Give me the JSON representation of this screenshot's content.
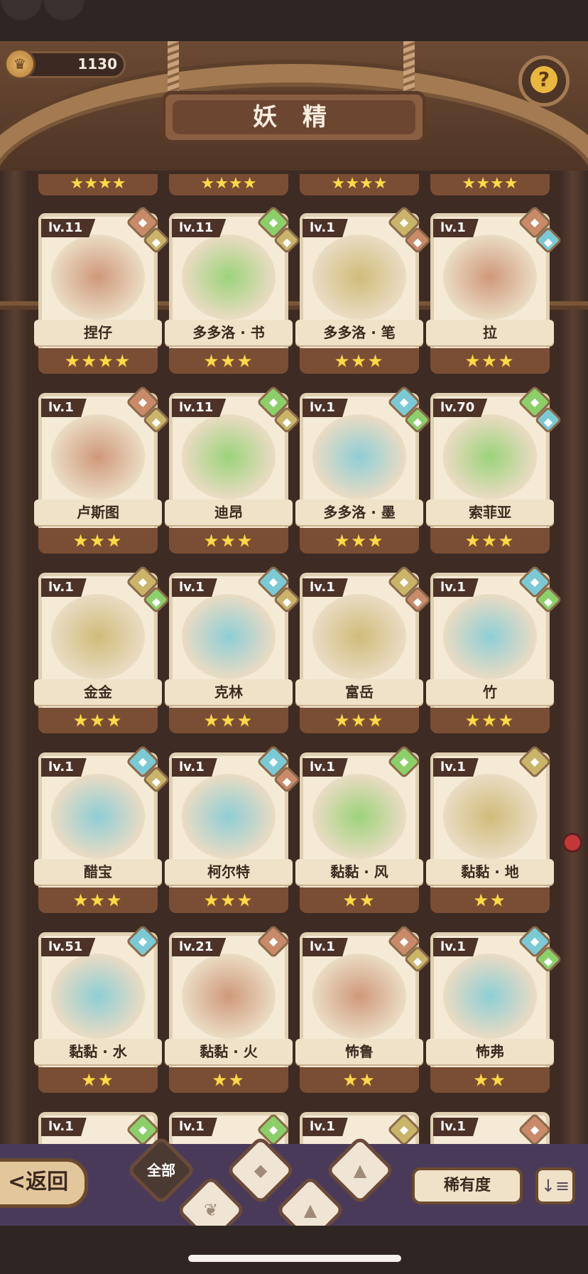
{
  "header": {
    "title": "妖 精",
    "coins": "1130",
    "help_symbol": "?"
  },
  "colors": {
    "water": "#7cc9d6",
    "plant": "#8ccf6a",
    "earth": "#c9b46a",
    "fire": "#c98a6a",
    "star": "#ffd94a"
  },
  "top_partial_stars": [
    "★★★★",
    "★★★★",
    "★★★★",
    "★★★★"
  ],
  "cards": [
    {
      "level": "lv.11",
      "name": "捏仔",
      "stars": "★★★★",
      "el1": "fire",
      "el2": "earth"
    },
    {
      "level": "lv.11",
      "name": "多多洛 · 书",
      "stars": "★★★",
      "el1": "plant",
      "el2": "earth"
    },
    {
      "level": "lv.1",
      "name": "多多洛 · 笔",
      "stars": "★★★",
      "el1": "earth",
      "el2": "fire"
    },
    {
      "level": "lv.1",
      "name": "拉",
      "stars": "★★★",
      "el1": "fire",
      "el2": "water"
    },
    {
      "level": "lv.1",
      "name": "卢斯图",
      "stars": "★★★",
      "el1": "fire",
      "el2": "earth"
    },
    {
      "level": "lv.11",
      "name": "迪昂",
      "stars": "★★★",
      "el1": "plant",
      "el2": "earth"
    },
    {
      "level": "lv.1",
      "name": "多多洛 · 墨",
      "stars": "★★★",
      "el1": "water",
      "el2": "plant"
    },
    {
      "level": "lv.70",
      "name": "索菲亚",
      "stars": "★★★",
      "el1": "plant",
      "el2": "water"
    },
    {
      "level": "lv.1",
      "name": "金金",
      "stars": "★★★",
      "el1": "earth",
      "el2": "plant"
    },
    {
      "level": "lv.1",
      "name": "克林",
      "stars": "★★★",
      "el1": "water",
      "el2": "earth"
    },
    {
      "level": "lv.1",
      "name": "富岳",
      "stars": "★★★",
      "el1": "earth",
      "el2": "fire"
    },
    {
      "level": "lv.1",
      "name": "竹",
      "stars": "★★★",
      "el1": "water",
      "el2": "plant"
    },
    {
      "level": "lv.1",
      "name": "醋宝",
      "stars": "★★★",
      "el1": "water",
      "el2": "earth"
    },
    {
      "level": "lv.1",
      "name": "柯尔特",
      "stars": "★★★",
      "el1": "water",
      "el2": "fire"
    },
    {
      "level": "lv.1",
      "name": "黏黏 · 风",
      "stars": "★★",
      "el1": "plant",
      "el2": ""
    },
    {
      "level": "lv.1",
      "name": "黏黏 · 地",
      "stars": "★★",
      "el1": "earth",
      "el2": ""
    },
    {
      "level": "lv.51",
      "name": "黏黏 · 水",
      "stars": "★★",
      "el1": "water",
      "el2": ""
    },
    {
      "level": "lv.21",
      "name": "黏黏 · 火",
      "stars": "★★",
      "el1": "fire",
      "el2": ""
    },
    {
      "level": "lv.1",
      "name": "怖鲁",
      "stars": "★★",
      "el1": "fire",
      "el2": "earth"
    },
    {
      "level": "lv.1",
      "name": "怖弗",
      "stars": "★★",
      "el1": "water",
      "el2": "plant"
    }
  ],
  "bottom_partial": [
    {
      "level": "lv.1",
      "el1": "plant"
    },
    {
      "level": "lv.1",
      "el1": "plant"
    },
    {
      "level": "lv.1",
      "el1": "earth"
    },
    {
      "level": "lv.1",
      "el1": "fire"
    }
  ],
  "footer": {
    "back_label": "返回",
    "back_arrow": "<",
    "filter_all": "全部",
    "sort_label": "稀有度",
    "order_icon": "↓≡"
  }
}
